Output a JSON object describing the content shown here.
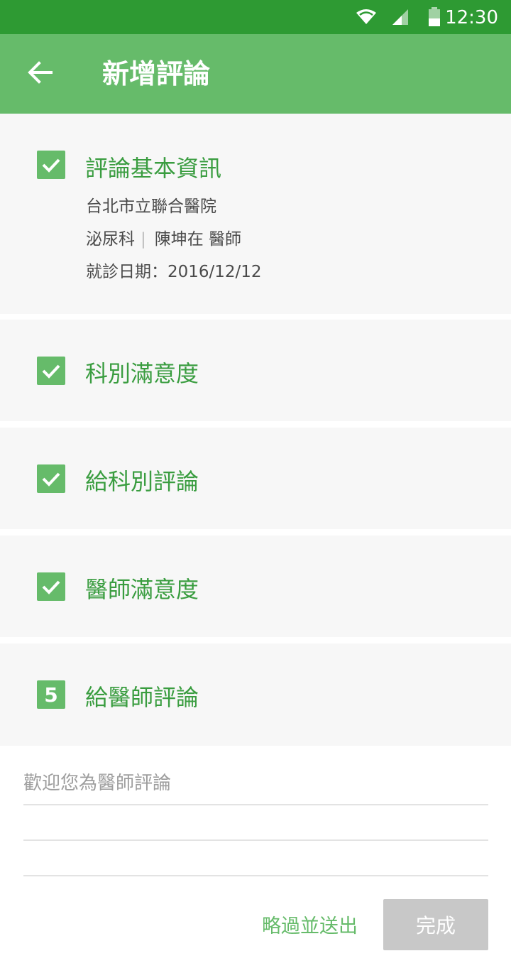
{
  "status_bar": {
    "time": "12:30",
    "icons": [
      "wifi-icon",
      "cell-signal-icon",
      "battery-icon"
    ]
  },
  "app_bar": {
    "title": "新增評論",
    "back_icon": "arrow-left-icon"
  },
  "steps": [
    {
      "state": "done",
      "title": "評論基本資訊",
      "hospital": "台北市立聯合醫院",
      "department": "泌尿科",
      "separator": "|",
      "doctor": "陳坤在 醫師",
      "visit_date": "就診日期：2016/12/12"
    },
    {
      "state": "done",
      "title": "科別滿意度"
    },
    {
      "state": "done",
      "title": "給科別評論"
    },
    {
      "state": "done",
      "title": "醫師滿意度"
    },
    {
      "state": "current",
      "number": "5",
      "title": "給醫師評論"
    }
  ],
  "comment": {
    "placeholder": "歡迎您為醫師評論"
  },
  "actions": {
    "skip_label": "略過並送出",
    "done_label": "完成"
  },
  "colors": {
    "status_bar": "#2e9a33",
    "app_bar": "#66bb6a",
    "accent_text": "#3a9d40",
    "section_bg": "#f7f7f7",
    "disabled_button": "#c8c8c8"
  }
}
